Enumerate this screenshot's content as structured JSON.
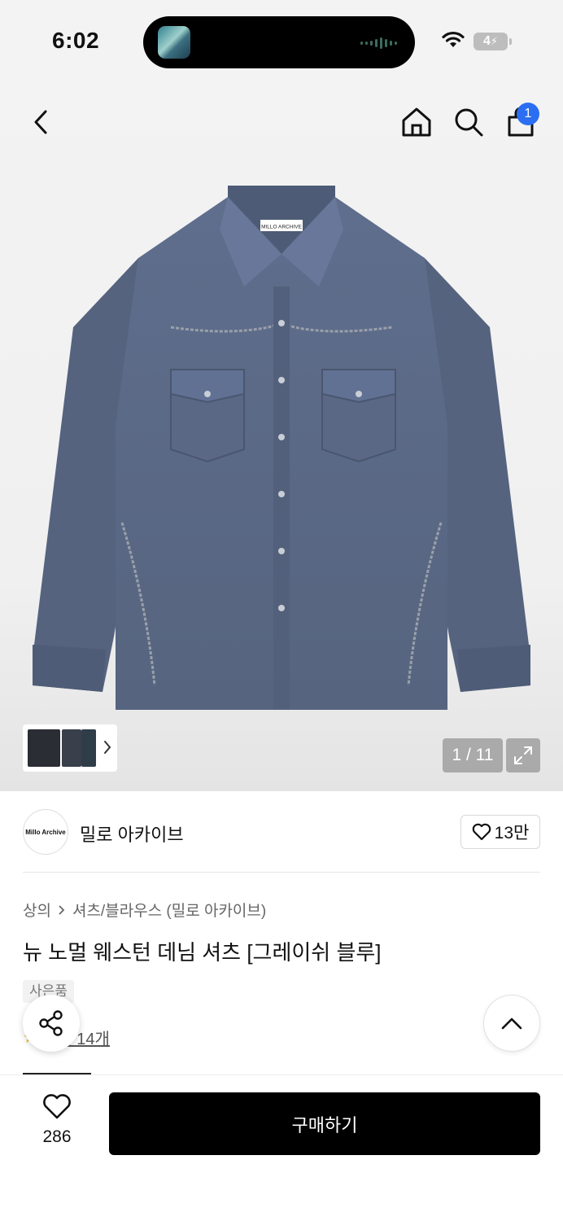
{
  "status_bar": {
    "time": "6:02",
    "battery": "4"
  },
  "nav": {
    "back_icon": "chevron-left-icon",
    "home_icon": "home-icon",
    "search_icon": "search-icon",
    "cart_icon": "shopping-bag-icon",
    "cart_count": "1"
  },
  "gallery": {
    "counter": "1 / 11",
    "expand_icon": "expand-icon"
  },
  "brand": {
    "logo_text": "Millo Archive",
    "name": "밀로 아카이브",
    "likes": "13만"
  },
  "product": {
    "breadcrumb": [
      "상의",
      "셔츠/블라우스 (밀로 아카이브)"
    ],
    "title": "뉴 노멀 웨스턴 데님 셔츠 [그레이쉬 블루]",
    "gift_badge": "사은품",
    "review_text": "후기 14개",
    "shirt_label": "MILLO ARCHIVE"
  },
  "bottom_bar": {
    "wish_count": "286",
    "buy_label": "구매하기"
  },
  "colors": {
    "accent_badge": "#2b6ef2",
    "buy_button": "#000000",
    "denim": "#5b6a88"
  }
}
